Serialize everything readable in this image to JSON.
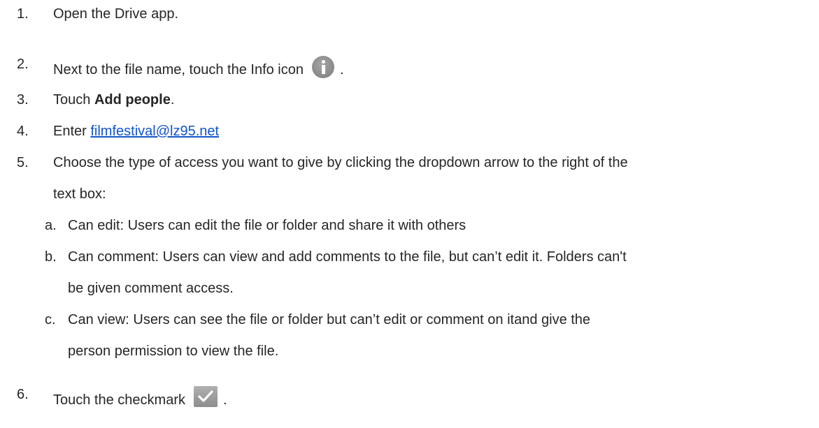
{
  "steps": [
    {
      "num": "1.",
      "text": "Open the Drive app."
    },
    {
      "num": "2.",
      "text": "Next to the file name, touch the Info icon",
      "suffix": "."
    },
    {
      "num": "3.",
      "text_pre": "Touch ",
      "bold": "Add people",
      "text_post": "."
    },
    {
      "num": "4.",
      "text_pre": "Enter ",
      "link": "filmfestival@lz95.net"
    },
    {
      "num": "5.",
      "line1": "Choose the type of access you want to give by clicking the dropdown arrow to the right of the",
      "line2": "text box:"
    },
    {
      "num": "6.",
      "text": "Touch the checkmark",
      "suffix": "."
    }
  ],
  "substeps": [
    {
      "letter": "a.",
      "line1": "Can edit: Users can edit the file or folder and share it with others"
    },
    {
      "letter": "b.",
      "line1": "Can comment:  Users can view and add comments to the file, but can’t edit it. Folders can't",
      "line2": "be given comment access."
    },
    {
      "letter": "c.",
      "line1": "Can view:  Users can see the file or folder but can’t edit or comment on itand give the",
      "line2": "person permission to view the file."
    }
  ],
  "icons": {
    "info": "info-icon",
    "check": "checkmark-icon"
  },
  "colors": {
    "text": "#262626",
    "link": "#1155cc",
    "icon_gray": "#8e8e8e"
  }
}
